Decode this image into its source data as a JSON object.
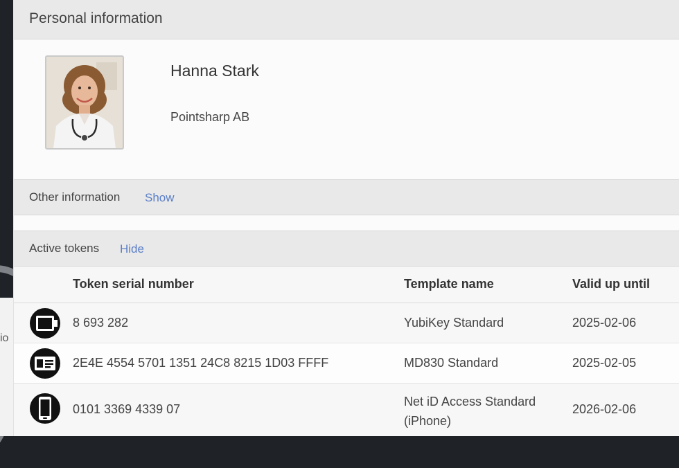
{
  "background": {
    "partial_label": "io"
  },
  "personal": {
    "title": "Personal information",
    "name": "Hanna Stark",
    "organization": "Pointsharp AB"
  },
  "other_info": {
    "label": "Other information",
    "toggle": "Show"
  },
  "active_tokens": {
    "label": "Active tokens",
    "toggle": "Hide",
    "columns": {
      "serial": "Token serial number",
      "template": "Template name",
      "valid": "Valid up until"
    },
    "rows": [
      {
        "icon": "usb-token-icon",
        "serial": "8 693 282",
        "template": "YubiKey Standard",
        "template_line2": "",
        "valid": "2025-02-06"
      },
      {
        "icon": "smart-card-icon",
        "serial": "2E4E 4554 5701 1351 24C8 8215 1D03 FFFF",
        "template": "MD830 Standard",
        "template_line2": "",
        "valid": "2025-02-05"
      },
      {
        "icon": "mobile-phone-icon",
        "serial": "0101 3369 4339 07",
        "template": "Net iD Access Standard",
        "template_line2": "(iPhone)",
        "valid": "2026-02-06"
      }
    ]
  },
  "colors": {
    "link": "#5b7fc7",
    "header_bg": "#e9e9e9",
    "panel_bg": "#fbfbfb"
  }
}
